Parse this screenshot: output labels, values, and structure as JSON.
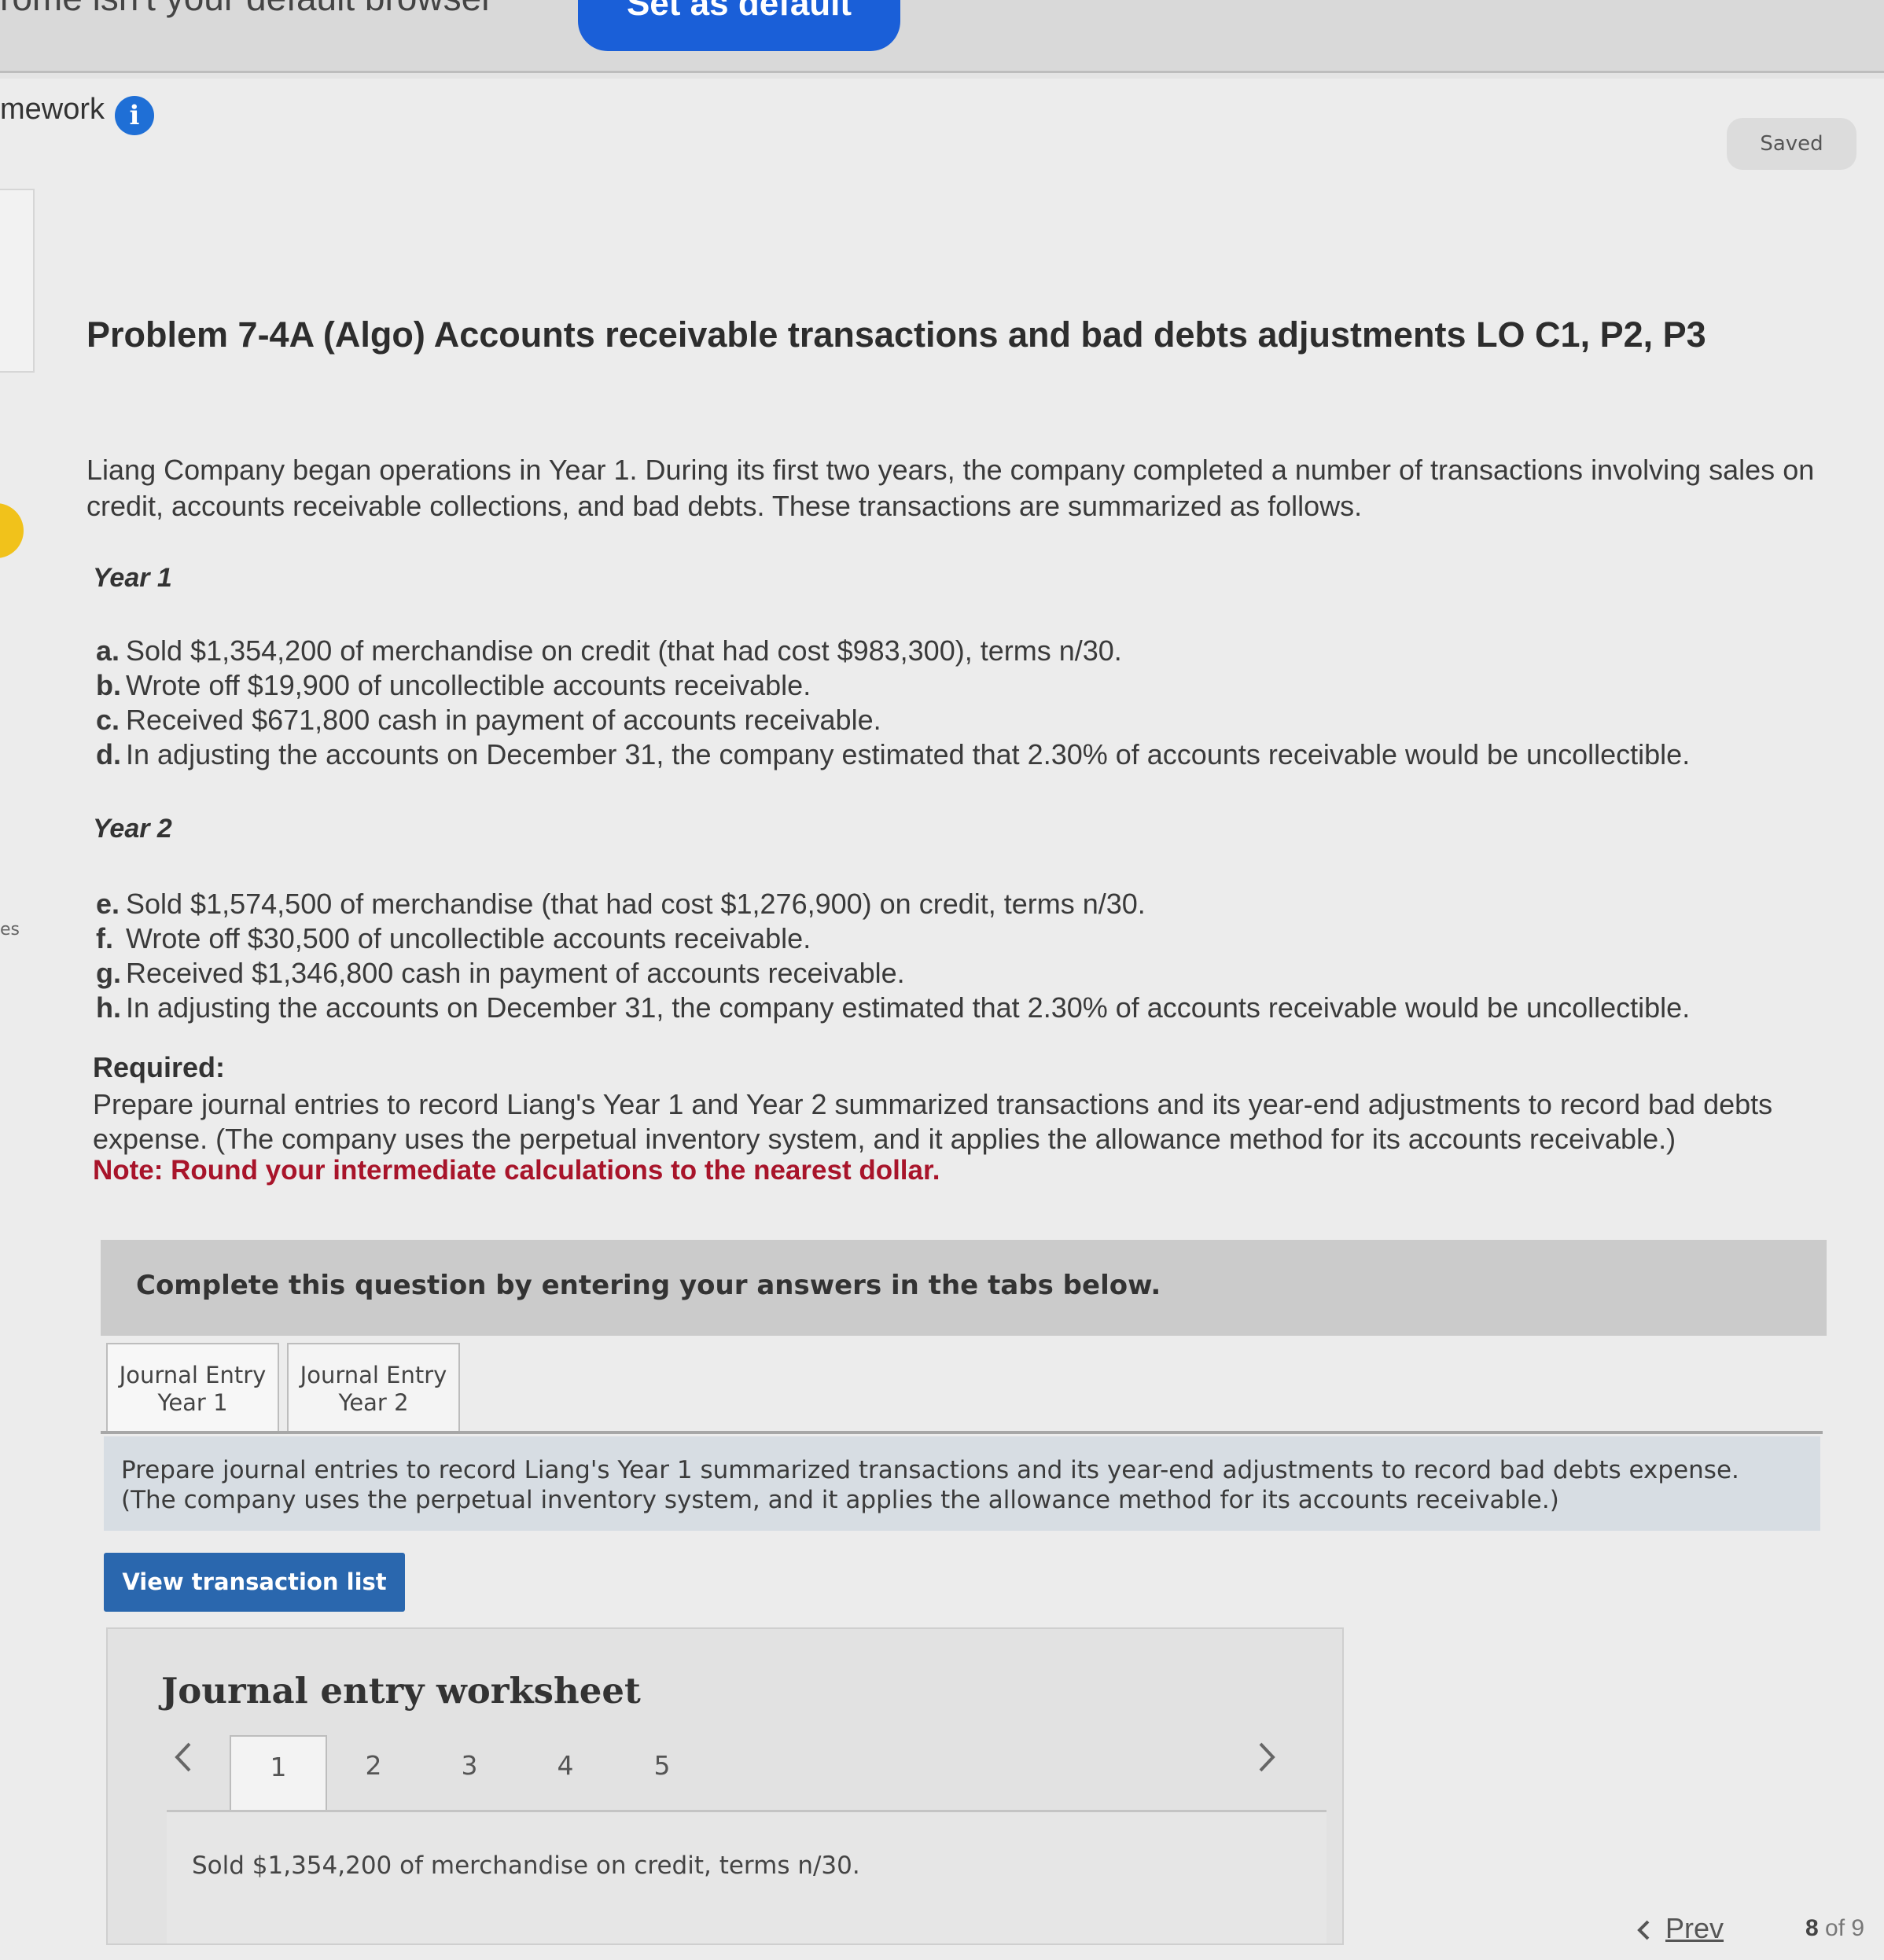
{
  "browser_banner": {
    "message": "rome isn't your default browser",
    "button_label": "Set as default"
  },
  "header": {
    "breadcrumb": "mework",
    "info_icon": "i",
    "status": "Saved"
  },
  "problem": {
    "title": "Problem 7-4A (Algo) Accounts receivable transactions and bad debts adjustments LO C1, P2, P3",
    "intro": "Liang Company began operations in Year 1. During its first two years, the company completed a number of transactions involving sales on credit, accounts receivable collections, and bad debts. These transactions are summarized as follows.",
    "years": [
      {
        "label": "Year 1",
        "items": [
          {
            "letter": "a.",
            "text": "Sold $1,354,200 of merchandise on credit (that had cost $983,300), terms n/30."
          },
          {
            "letter": "b.",
            "text": "Wrote off $19,900 of uncollectible accounts receivable."
          },
          {
            "letter": "c.",
            "text": "Received $671,800 cash in payment of accounts receivable."
          },
          {
            "letter": "d.",
            "text": "In adjusting the accounts on December 31, the company estimated that 2.30% of accounts receivable would be uncollectible."
          }
        ]
      },
      {
        "label": "Year 2",
        "items": [
          {
            "letter": "e.",
            "text": "Sold $1,574,500 of merchandise (that had cost $1,276,900) on credit, terms n/30."
          },
          {
            "letter": "f.",
            "text": "Wrote off $30,500 of uncollectible accounts receivable."
          },
          {
            "letter": "g.",
            "text": "Received $1,346,800 cash in payment of accounts receivable."
          },
          {
            "letter": "h.",
            "text": "In adjusting the accounts on December 31, the company estimated that 2.30% of accounts receivable would be uncollectible."
          }
        ]
      }
    ],
    "required_heading": "Required:",
    "required_text": "Prepare journal entries to record Liang's Year 1 and Year 2 summarized transactions and its year-end adjustments to record bad debts expense. (The company uses the perpetual inventory system, and it applies the allowance method for its accounts receivable.)",
    "note": "Note: Round your intermediate calculations to the nearest dollar."
  },
  "answer_area": {
    "banner": "Complete this question by entering your answers in the tabs below.",
    "tabs": [
      {
        "line1": "Journal Entry",
        "line2": "Year 1"
      },
      {
        "line1": "Journal Entry",
        "line2": "Year 2"
      }
    ],
    "instruction": "Prepare journal entries to record Liang's Year 1 summarized transactions and its year-end adjustments to record bad debts expense. (The company uses the perpetual inventory system, and it applies the allowance method for its accounts receivable.)",
    "view_button": "View transaction list"
  },
  "worksheet": {
    "title": "Journal entry worksheet",
    "prev_icon": "chevron-left-icon",
    "next_icon": "chevron-right-icon",
    "pages": [
      "1",
      "2",
      "3",
      "4",
      "5"
    ],
    "active_page": "1",
    "description": "Sold $1,354,200 of merchandise on credit, terms n/30."
  },
  "footer": {
    "prev_label": "Prev",
    "current": "8",
    "of_text": "of 9"
  },
  "colors": {
    "primary_button": "#2a67ae",
    "note_red": "#a8142a",
    "banner_button": "#1a5fd8"
  }
}
